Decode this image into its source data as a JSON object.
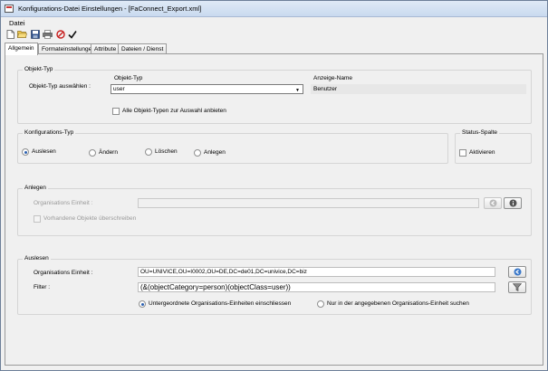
{
  "window": {
    "title": "Konfigurations-Datei Einstellungen - [FaConnect_Export.xml]"
  },
  "menu": {
    "datei": "Datei"
  },
  "toolbar": {
    "icons": [
      "new-file-icon",
      "open-folder-icon",
      "save-icon",
      "print-icon",
      "cancel-icon",
      "checkmark-icon"
    ]
  },
  "tabs": [
    {
      "label": "Allgemein",
      "active": true
    },
    {
      "label": "Formateinstellungen",
      "active": false
    },
    {
      "label": "Attribute",
      "active": false
    },
    {
      "label": "Dateien / Dienst",
      "active": false
    }
  ],
  "objekt_typ": {
    "group_label": "Objekt-Typ",
    "select_label": "Objekt-Typ auswählen :",
    "column_header": "Objekt-Typ",
    "display_header": "Anzeige-Name",
    "selected_value": "user",
    "display_name": "Benutzer",
    "all_types_checkbox": "Alle Objekt-Typen zur Auswahl anbieten",
    "all_types_checked": false
  },
  "konfigurations_typ": {
    "group_label": "Konfigurations-Typ",
    "options": [
      "Auslesen",
      "Ändern",
      "Löschen",
      "Anlegen"
    ],
    "selected": "Auslesen"
  },
  "status_spalte": {
    "group_label": "Status-Spalte",
    "checkbox_label": "Aktivieren",
    "checked": false
  },
  "anlegen": {
    "group_label": "Anlegen",
    "org_unit_label": "Organisations Einheit :",
    "org_unit_value": "",
    "overwrite_label": "Vorhandene Objekte überschreiben",
    "overwrite_checked": false
  },
  "auslesen": {
    "group_label": "Auslesen",
    "org_unit_label": "Organisations Einheit :",
    "org_unit_value": "OU=UNIVICE,OU=I0002,OU=DE,DC=de01,DC=univice,DC=biz",
    "filter_label": "Filter :",
    "filter_value": "(&(objectCategory=person)(objectClass=user))",
    "scope_options": [
      "Untergeordnete Organisations-Einheiten einschliessen",
      "Nur in der angegebenen Organisations-Einheit suchen"
    ],
    "scope_selected": 0
  },
  "colors": {
    "title_bar": "#c9daef",
    "window_bg": "#f0f0f0",
    "radio_dot": "#2a5fb0",
    "disabled_text": "#9a9a9a"
  }
}
